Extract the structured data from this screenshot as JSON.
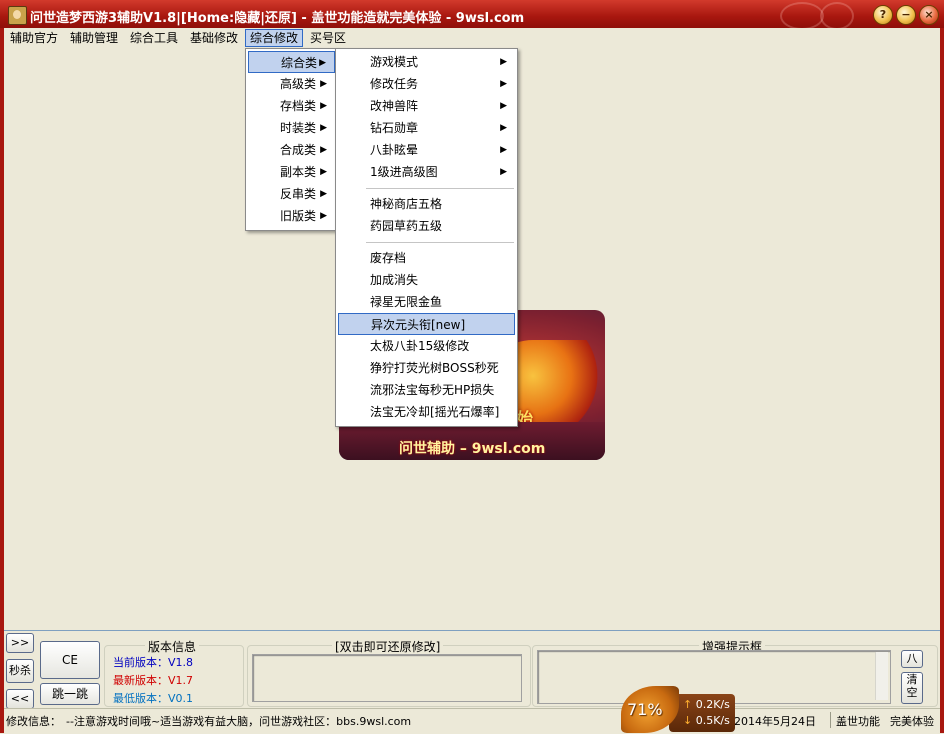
{
  "window": {
    "title": "问世造梦西游3辅助V1.8|[Home:隐藏|还原] - 盖世功能造就完美体验 - 9wsl.com",
    "buttons": {
      "help": "?",
      "minimize": "−",
      "close": "×"
    }
  },
  "menubar": {
    "items": [
      "辅助官方",
      "辅助管理",
      "综合工具",
      "基础修改",
      "综合修改",
      "买号区"
    ],
    "active_index": 4
  },
  "submenu": {
    "items": [
      "综合类",
      "高级类",
      "存档类",
      "时装类",
      "合成类",
      "副本类",
      "反串类",
      "旧版类"
    ],
    "active_index": 0
  },
  "flyout": {
    "groups": [
      [
        "游戏模式",
        "修改任务",
        "改神兽阵",
        "钻石勋章",
        "八卦眩晕",
        "1级进高级图"
      ],
      [
        "神秘商店五格",
        "药园草药五级"
      ],
      [
        "废存档",
        "加成消失",
        "禄星无限金鱼",
        "异次元头衔[new]",
        "太极八卦15级修改",
        "狰狞打荧光树BOSS秒死",
        "流邪法宝每秒无HP损失",
        "法宝无冷却[摇光石爆率]"
      ]
    ],
    "submenu_in_first_group": true,
    "highlighted": "异次元头衔[new]"
  },
  "banner": {
    "text": "问世辅助 – 9wsl.com",
    "badge": "始"
  },
  "bottom": {
    "nav_buttons": [
      ">>",
      "秒杀",
      "<<"
    ],
    "ce_button": "CE",
    "jump_button": "跳一跳",
    "version_group": {
      "title": "版本信息",
      "current": "当前版本：V1.8",
      "latest": "最新版本：V1.7",
      "minimum": "最低版本：V0.1",
      "colors": {
        "current": "#0000c0",
        "latest": "#d00000",
        "minimum": "#0070c0"
      }
    },
    "restore_group": {
      "title": "[双击即可还原修改]"
    },
    "hint_group": {
      "title": "增强提示框"
    },
    "hint_buttons": [
      "八",
      "清空"
    ]
  },
  "statusbar": {
    "label": "修改信息：",
    "message": "--注意游戏时间哦~适当游戏有益大脑，问世游戏社区：bbs.9wsl.com",
    "date": "2014年5月24日",
    "right1": "盖世功能",
    "right2": "完美体验"
  },
  "network": {
    "percent": "71%",
    "up": "0.2K/s",
    "down": "0.5K/s"
  },
  "colors": {
    "title_bar": "#b81f14",
    "menu_highlight": "#c1d2ee",
    "menu_border": "#316ac5"
  }
}
